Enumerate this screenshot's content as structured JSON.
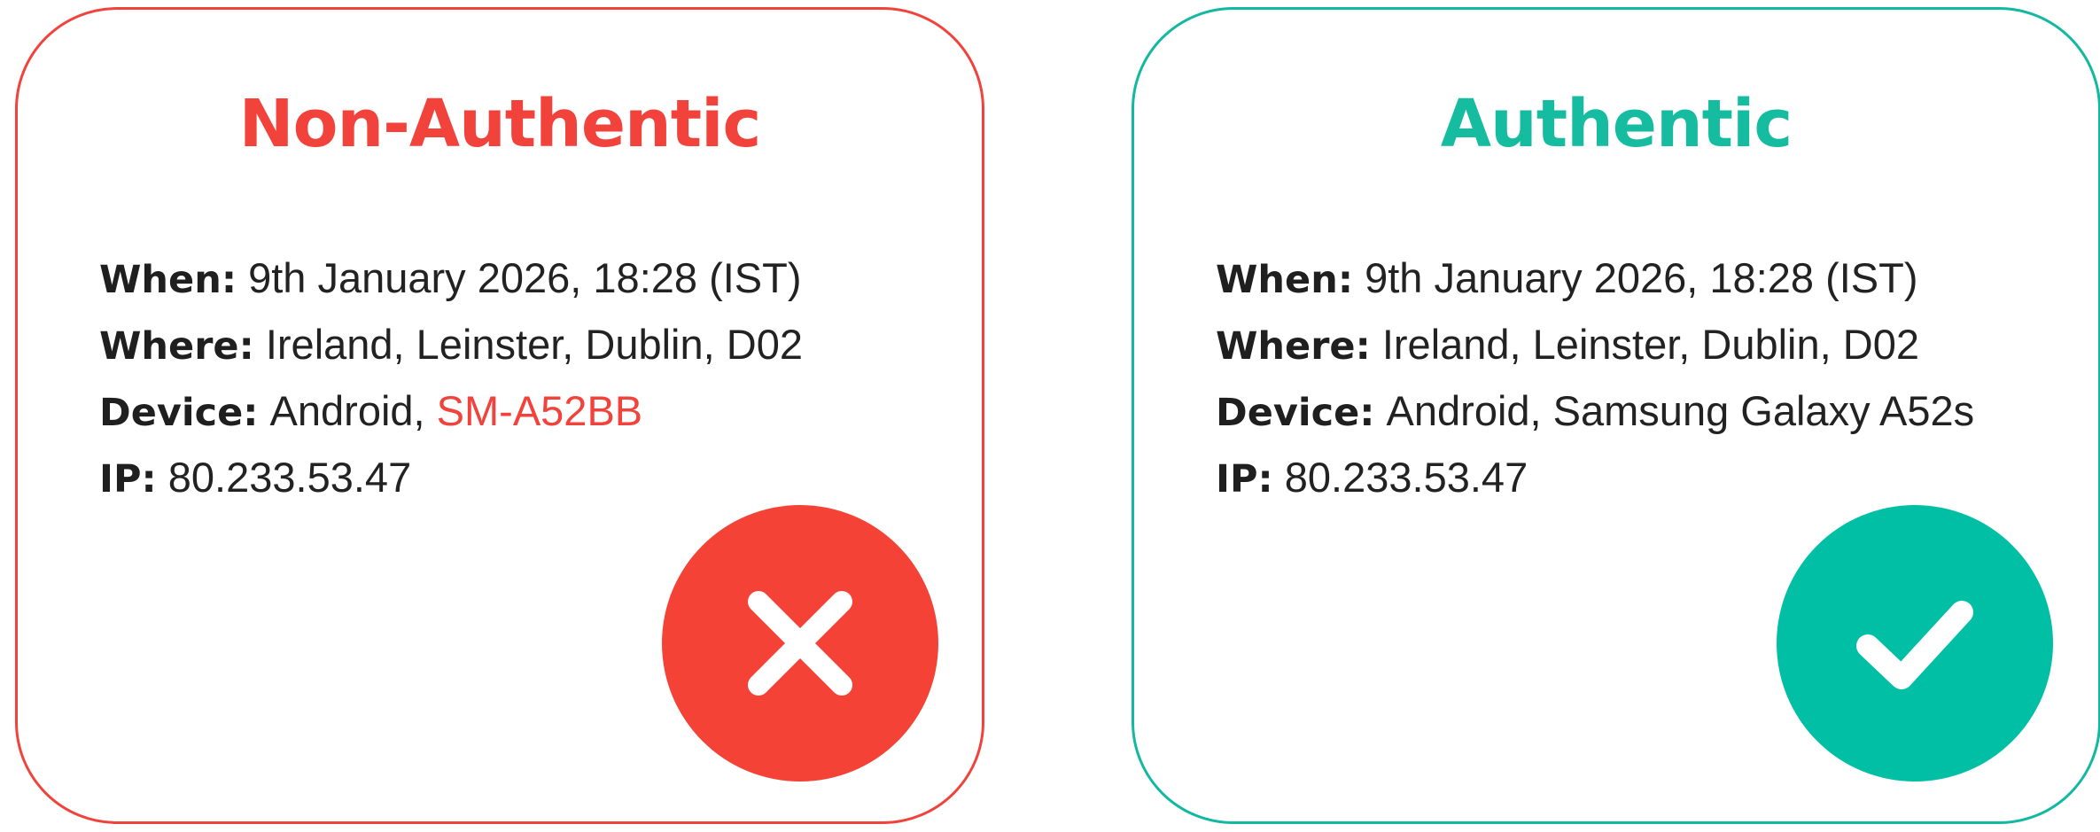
{
  "cards": [
    {
      "title": "Non-Authentic",
      "status": "fail",
      "accent_color": "#f1433b",
      "badge_icon": "close-icon",
      "when_label": "When:",
      "when_value": "9th January 2026, 18:28 (IST)",
      "where_label": "Where:",
      "where_value": "Ireland, Leinster, Dublin, D02",
      "device_label": "Device:",
      "device_value_prefix": "Android, ",
      "device_value_model": "SM-A52BB",
      "ip_label": "IP:",
      "ip_value": "80.233.53.47"
    },
    {
      "title": "Authentic",
      "status": "pass",
      "accent_color": "#12b8a0",
      "badge_icon": "check-icon",
      "when_label": "When:",
      "when_value": "9th January 2026, 18:28 (IST)",
      "where_label": "Where:",
      "where_value": "Ireland, Leinster, Dublin, D02",
      "device_label": "Device:",
      "device_value_prefix": "Android, ",
      "device_value_model": "Samsung Galaxy A52s",
      "ip_label": "IP:",
      "ip_value": "80.233.53.47"
    }
  ]
}
